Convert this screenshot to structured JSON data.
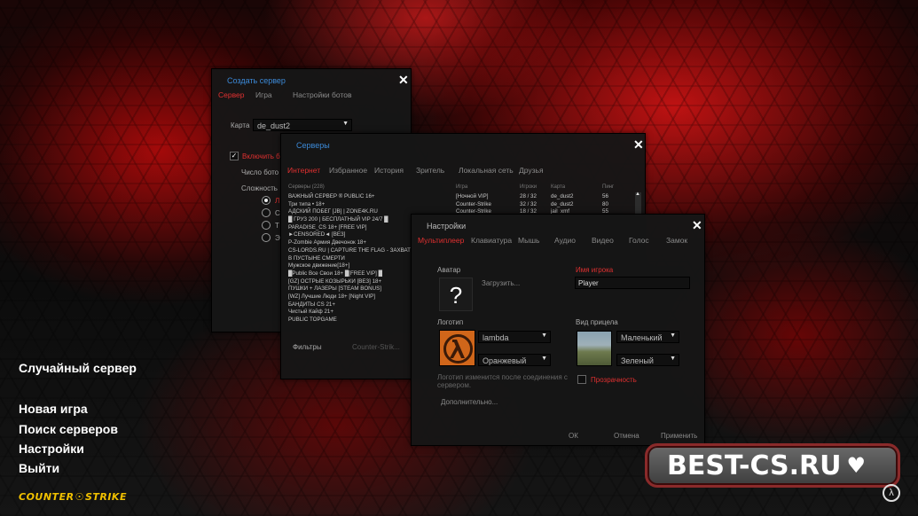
{
  "main_menu": {
    "random_server": "Случайный сервер",
    "new_game": "Новая игра",
    "find_servers": "Поиск серверов",
    "settings": "Настройки",
    "exit": "Выйти"
  },
  "logo_text_1": "COUNTER",
  "logo_text_2": "STRIKE",
  "brand": {
    "text": "BEST-CS.RU"
  },
  "create_server": {
    "title": "Создать сервер",
    "tabs": [
      "Сервер",
      "Игра",
      "Настройки ботов"
    ],
    "map_label": "Карта",
    "map_value": "de_dust2",
    "enable_bots_label": "Включить б",
    "bot_count_label": "Число бото",
    "difficulty_label": "Сложность",
    "difficulty_options": [
      "Л",
      "С",
      "Т",
      "Э"
    ]
  },
  "servers": {
    "title": "Серверы",
    "tabs": [
      "Интернет",
      "Избранное",
      "История",
      "Зритель",
      "Локальная сеть",
      "Друзья"
    ],
    "columns": [
      "Серверы (228)",
      "Игра",
      "Игроки",
      "Карта",
      "Пинг"
    ],
    "rows": [
      {
        "name": "ВАЖНЫЙ СЕРВЕР ® PUBLIC 16+",
        "game": "[Ночной VIP]",
        "players": "28 / 32",
        "map": "de_dust2",
        "ping": "56"
      },
      {
        "name": "Три типа • 18+",
        "game": "Counter-Strike",
        "players": "32 / 32",
        "map": "de_dust2",
        "ping": "80"
      },
      {
        "name": "АДСКИЙ ПОБЕГ [JB] | ZONE4K.RU",
        "game": "Counter-Strike",
        "players": "18 / 32",
        "map": "jail_xmf",
        "ping": "55"
      },
      {
        "name": "█ ГРУЗ 200 | БЕСПЛАТНЫЙ VIP 24/7 █",
        "game": "",
        "players": "",
        "map": "",
        "ping": ""
      },
      {
        "name": "PARADISE_CS 18+ [FREE VIP]",
        "game": "",
        "players": "",
        "map": "",
        "ping": ""
      },
      {
        "name": "►CENSORED◄ [ВЕЗ]",
        "game": "",
        "players": "",
        "map": "",
        "ping": ""
      },
      {
        "name": "P-Zombie Армия Двечонок 18+",
        "game": "",
        "players": "",
        "map": "",
        "ping": ""
      },
      {
        "name": "CS-LORDS.RU | CAPTURE THE FLAG - ЗАХВАТ",
        "game": "",
        "players": "",
        "map": "",
        "ping": ""
      },
      {
        "name": "В ПУСТЫНЕ СМЕРТИ",
        "game": "",
        "players": "",
        "map": "",
        "ping": ""
      },
      {
        "name": "Мужское движение[18+]",
        "game": "",
        "players": "",
        "map": "",
        "ping": ""
      },
      {
        "name": "█Public Все Свои 18+ █[FREE VIP] █",
        "game": "",
        "players": "",
        "map": "",
        "ping": ""
      },
      {
        "name": "[GZ] ОСТРЫЕ КОЗЫРЬКИ [ВЕЗ] 18+",
        "game": "",
        "players": "",
        "map": "",
        "ping": ""
      },
      {
        "name": "ПУШКИ + ЛАЗЕРЫ [STEAM BONUS]",
        "game": "",
        "players": "",
        "map": "",
        "ping": ""
      },
      {
        "name": "[WZ] Лучшие Люди 18+ [Night VIP]",
        "game": "",
        "players": "",
        "map": "",
        "ping": ""
      },
      {
        "name": "БАНДИТЫ CS 21+",
        "game": "",
        "players": "",
        "map": "",
        "ping": ""
      },
      {
        "name": "Чистый Кайф 21+",
        "game": "",
        "players": "",
        "map": "",
        "ping": ""
      },
      {
        "name": "PUBLIC TOPGAME",
        "game": "",
        "players": "",
        "map": "",
        "ping": ""
      }
    ],
    "filters_label": "Фильтры",
    "game_filter_value": "Counter-Strik..."
  },
  "settings": {
    "title": "Настройки",
    "tabs": [
      "Мультиплеер",
      "Клавиатура",
      "Мышь",
      "Аудио",
      "Видео",
      "Голос",
      "Замок"
    ],
    "avatar_label": "Аватар",
    "avatar_placeholder": "?",
    "upload_button": "Загрузить...",
    "player_name_label": "Имя игрока",
    "player_name_value": "Player",
    "logo_label": "Логотип",
    "logo_value": "lambda",
    "logo_color_value": "Оранжевый",
    "crosshair_label": "Вид прицела",
    "crosshair_size_value": "Маленький",
    "crosshair_color_value": "Зеленый",
    "transparency_label": "Прозрачность",
    "logo_note": "Логотип изменится после соединения с сервером.",
    "advanced_button": "Дополнительно...",
    "ok_button": "ОК",
    "cancel_button": "Отмена",
    "apply_button": "Применить"
  },
  "colors": {
    "accent_red": "#e03030",
    "title_blue": "#3c8ad8",
    "logo_yellow": "#f0c000"
  }
}
